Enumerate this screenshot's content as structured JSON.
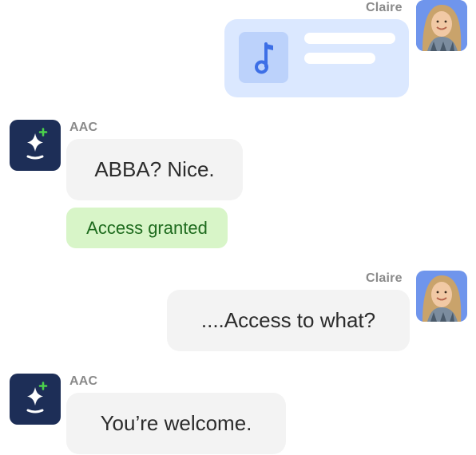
{
  "messages": [
    {
      "sender": "Claire",
      "kind": "attachment",
      "attachment_icon": "music-note-icon"
    },
    {
      "sender": "AAC",
      "kind": "text",
      "text": "ABBA? Nice.",
      "chip": "Access granted"
    },
    {
      "sender": "Claire",
      "kind": "text",
      "text": "....Access to what?"
    },
    {
      "sender": "AAC",
      "kind": "text",
      "text": "You’re welcome."
    }
  ],
  "colors": {
    "user_card": "#dbe8ff",
    "user_card_thumb": "#bcd2fb",
    "music_note": "#3d6fe6",
    "bot_avatar": "#1d2e57",
    "bot_sparkle_accent": "#4bd14b",
    "bubble": "#f3f3f3",
    "chip_bg": "#d8f5c8",
    "chip_text": "#1e6b1e",
    "sender_label": "#8a8a8a"
  }
}
